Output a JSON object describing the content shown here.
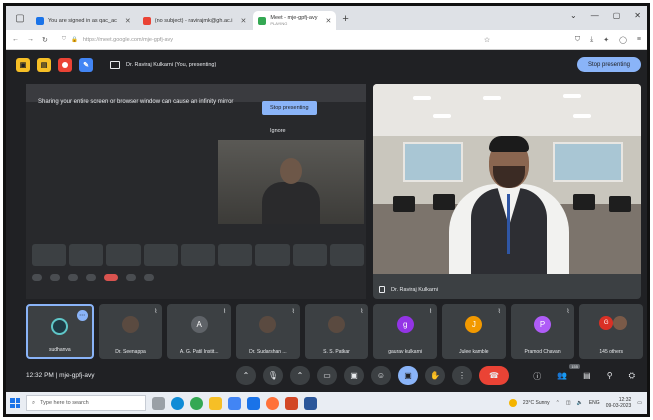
{
  "browser": {
    "tabs": [
      {
        "title": "You are signed in as qac_ac",
        "fav_color": "#1a73e8",
        "active": false
      },
      {
        "title": "(no subject) - ravirajmk@gh.ac.i",
        "fav_color": "#ea4335",
        "active": false
      },
      {
        "title": "Meet - mje-gpfj-avy",
        "subtitle": "PLAYING",
        "fav_color": "#34a853",
        "active": true
      }
    ],
    "new_tab_icon": "+",
    "url": "https://meet.google.com/mje-gpfj-avy",
    "window_controls": [
      "⌄",
      "—",
      "▢",
      "✕"
    ]
  },
  "share_bar": {
    "app_buttons": [
      {
        "icon": "folder-icon",
        "color": "#f6bf26"
      },
      {
        "icon": "notes-icon",
        "color": "#f6bf26"
      },
      {
        "icon": "record-icon",
        "color": "#ea4335"
      },
      {
        "icon": "edit-icon",
        "color": "#4285f4"
      }
    ],
    "presenting_text": "Dr. Raviraj Kulkarni (You, presenting)",
    "stop_label": "Stop presenting"
  },
  "shared_screen": {
    "warning": "Sharing your entire screen or browser window can cause an infinity mirror",
    "stop_label": "Stop presenting",
    "ignore_label": "Ignore"
  },
  "camera_tile": {
    "name": "Dr. Raviraj Kulkarni"
  },
  "participants": [
    {
      "name": "sudhanva",
      "avatar": "logo",
      "active": true
    },
    {
      "name": "Dr. Seenappa",
      "avatar": "photo"
    },
    {
      "name": "A. G. Patil Instit...",
      "avatar": "letter",
      "letter": "A",
      "color": "#5f6368"
    },
    {
      "name": "Dr. Sudarshan ...",
      "avatar": "photo"
    },
    {
      "name": "S. S. Patkar",
      "avatar": "photo"
    },
    {
      "name": "gaurav kulkarni",
      "avatar": "letter",
      "letter": "g",
      "color": "#9334e6"
    },
    {
      "name": "Julee kamble",
      "avatar": "letter",
      "letter": "J",
      "color": "#f29900"
    },
    {
      "name": "Pramod Chavan",
      "avatar": "letter",
      "letter": "P",
      "color": "#af5cf7"
    },
    {
      "name": "145 others",
      "avatar": "others",
      "letter": "G",
      "color": "#d93025"
    }
  ],
  "meeting": {
    "info": "12:32 PM  |  mje-gpfj-avy",
    "people_badge": "155"
  },
  "taskbar": {
    "search_placeholder": "Type here to search",
    "weather": "23°C Sunny",
    "lang": "ENG",
    "time": "12:32",
    "date": "09-03-2023"
  }
}
